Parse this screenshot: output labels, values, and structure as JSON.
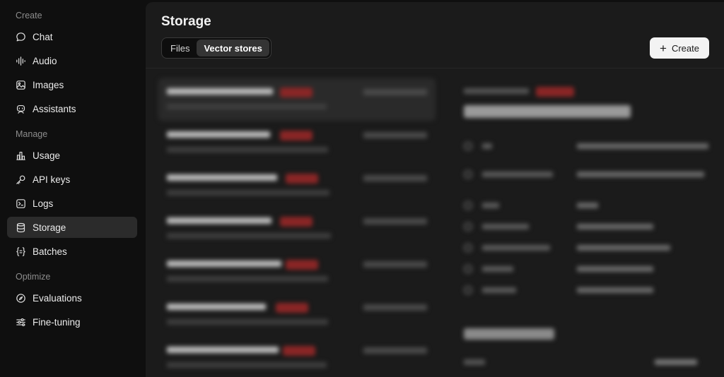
{
  "sidebar": {
    "sections": [
      {
        "label": "Create",
        "items": [
          {
            "label": "Chat",
            "icon": "chat-icon"
          },
          {
            "label": "Audio",
            "icon": "audio-waveform-icon"
          },
          {
            "label": "Images",
            "icon": "image-icon"
          },
          {
            "label": "Assistants",
            "icon": "assistant-bot-icon"
          }
        ]
      },
      {
        "label": "Manage",
        "items": [
          {
            "label": "Usage",
            "icon": "bar-chart-icon"
          },
          {
            "label": "API keys",
            "icon": "key-icon"
          },
          {
            "label": "Logs",
            "icon": "terminal-icon"
          },
          {
            "label": "Storage",
            "icon": "database-icon",
            "active": true
          },
          {
            "label": "Batches",
            "icon": "batches-braces-icon"
          }
        ]
      },
      {
        "label": "Optimize",
        "items": [
          {
            "label": "Evaluations",
            "icon": "compass-icon"
          },
          {
            "label": "Fine-tuning",
            "icon": "sliders-icon"
          }
        ]
      }
    ]
  },
  "main": {
    "title": "Storage",
    "tabs": [
      {
        "label": "Files",
        "active": false
      },
      {
        "label": "Vector stores",
        "active": true
      }
    ],
    "create_button": {
      "label": "Create",
      "icon": "plus-icon"
    }
  },
  "colors": {
    "background": "#0f0f0f",
    "panel": "#1b1b1b",
    "active_nav": "#2b2b2b",
    "badge_red": "#8a2626",
    "button_bg": "#f3f3f3"
  }
}
